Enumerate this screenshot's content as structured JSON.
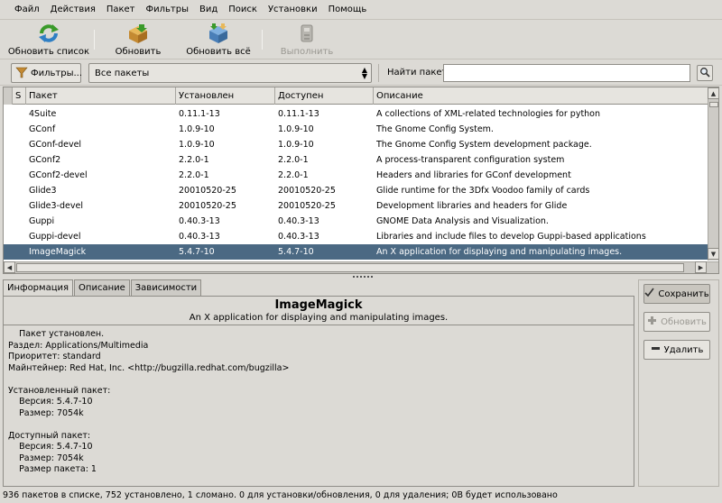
{
  "menu": [
    "Файл",
    "Действия",
    "Пакет",
    "Фильтры",
    "Вид",
    "Поиск",
    "Установки",
    "Помощь"
  ],
  "toolbar": {
    "refresh_list": "Обновить список",
    "update": "Обновить",
    "update_all": "Обновить всё",
    "run": "Выполнить"
  },
  "filter": {
    "filters_button": "Фильтры...",
    "combo_value": "Все пакеты",
    "find_label": "Найти пакет",
    "find_value": ""
  },
  "table": {
    "columns": [
      "S",
      "Пакет",
      "Установлен",
      "Доступен",
      "Описание"
    ],
    "rows": [
      {
        "name": "4Suite",
        "installed": "0.11.1-13",
        "available": "0.11.1-13",
        "desc": "A collections of XML-related technologies for python"
      },
      {
        "name": "GConf",
        "installed": "1.0.9-10",
        "available": "1.0.9-10",
        "desc": "The Gnome Config System."
      },
      {
        "name": "GConf-devel",
        "installed": "1.0.9-10",
        "available": "1.0.9-10",
        "desc": "The Gnome Config System development package."
      },
      {
        "name": "GConf2",
        "installed": "2.2.0-1",
        "available": "2.2.0-1",
        "desc": "A process-transparent configuration system"
      },
      {
        "name": "GConf2-devel",
        "installed": "2.2.0-1",
        "available": "2.2.0-1",
        "desc": "Headers and libraries for GConf development"
      },
      {
        "name": "Glide3",
        "installed": "20010520-25",
        "available": "20010520-25",
        "desc": "Glide runtime for the 3Dfx Voodoo family of cards"
      },
      {
        "name": "Glide3-devel",
        "installed": "20010520-25",
        "available": "20010520-25",
        "desc": "Development libraries and headers for Glide"
      },
      {
        "name": "Guppi",
        "installed": "0.40.3-13",
        "available": "0.40.3-13",
        "desc": "GNOME Data Analysis and Visualization."
      },
      {
        "name": "Guppi-devel",
        "installed": "0.40.3-13",
        "available": "0.40.3-13",
        "desc": "Libraries and include files to develop Guppi-based applications"
      },
      {
        "name": "ImageMagick",
        "installed": "5.4.7-10",
        "available": "5.4.7-10",
        "desc": "An X application for displaying and manipulating images."
      }
    ],
    "selected_index": 9
  },
  "tabs": [
    "Информация",
    "Описание",
    "Зависимости"
  ],
  "info": {
    "title": "ImageMagick",
    "subtitle": "An X application for displaying and manipulating images.",
    "lines": [
      "    Пакет установлен.",
      "Раздел: Applications/Multimedia",
      "Приоритет: standard",
      "Майнтейнер: Red Hat, Inc. <http://bugzilla.redhat.com/bugzilla>",
      "",
      "Установленный пакет:",
      "    Версия: 5.4.7-10",
      "    Размер: 7054k",
      "",
      "Доступный пакет:",
      "    Версия: 5.4.7-10",
      "    Размер: 7054k",
      "    Размер пакета: 1"
    ]
  },
  "actions": {
    "keep": "Сохранить",
    "update": "Обновить",
    "remove": "Удалить"
  },
  "status": "936 пакетов в списке, 752 установлено, 1 сломано. 0 для установки/обновления, 0 для удаления; 0B будет использовано"
}
